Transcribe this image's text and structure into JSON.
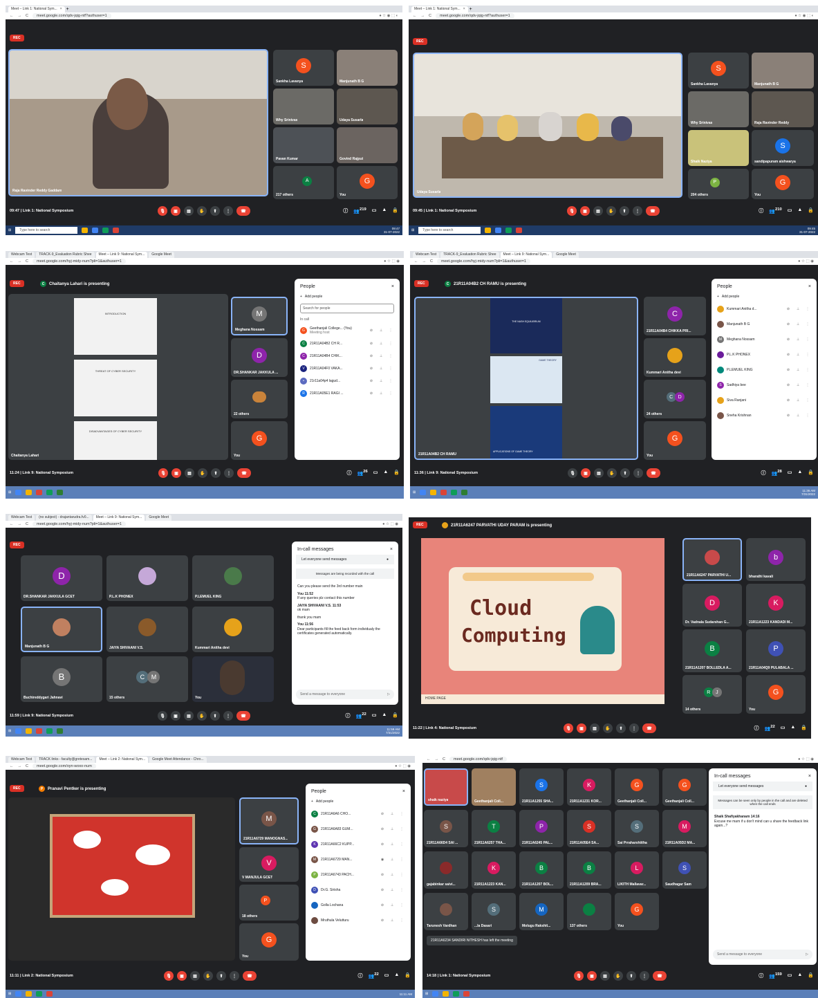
{
  "common": {
    "rec": "REC",
    "add_people": "Add people",
    "people": "People",
    "in_call": "In call",
    "search_people": "Search for people",
    "incall_messages": "In-call messages",
    "let_everyone": "Let everyone send messages",
    "taskbar_search": "Type here to search"
  },
  "s1": {
    "tab": "Meet – Link 1: National Sym...",
    "url": "meet.google.com/qdv-jqig-ntf?authuser=1",
    "main": "Raja Ravinder Reddy Gaddam",
    "tiles": [
      "Sankha Lavanya",
      "Manjunath B G",
      "Why Srinivas",
      "Udaya Susarla",
      "Pavan Kumar",
      "Govind Rajput",
      "217 others",
      "You"
    ],
    "time": "09:47",
    "meeting": "Link 1: National Symposium",
    "count": "219",
    "clock": "09:47",
    "date": "31-07-2022"
  },
  "s2": {
    "tab": "Meet – Link 1: National Sym...",
    "url": "meet.google.com/qdv-jqig-ntf?authuser=1",
    "main": "Udaya Susarla",
    "tiles": [
      "Sankha Lavanya",
      "Manjunath B G",
      "Why Srinivas",
      "Raja Ravinder Reddy",
      "Shaik Naziya",
      "sandipapuram aishwarya",
      "204 others",
      "You"
    ],
    "time": "09:45",
    "meeting": "Link 1: National Symposium",
    "count": "210",
    "clock": "09:45",
    "date": "31-07-2022"
  },
  "s3": {
    "tabs": [
      "Webcam Test",
      "TRACK-9_Evaluation Rubric Shee",
      "Meet – Link 9: National Sym...",
      "Google Meet"
    ],
    "url": "meet.google.com/hyj-midy-num?pli=1&authuser=1",
    "presenting": "Chaitanya Lahari is presenting",
    "main": "Chaitanya Lahari",
    "slides": [
      "INTRODUCTION",
      "THREAT OF CYBER SECURITY",
      "DISADVANTAGES OF CYBER SECURITY"
    ],
    "tiles": [
      "Meghana Nossam",
      "DR.SHANKAR JAKKULA ...",
      "22 others",
      "You"
    ],
    "people": [
      [
        "Geethanjali College... (You)",
        "Meeting host"
      ],
      [
        "21R11A04B2 CH R..."
      ],
      [
        "21R11A04B4 CHIK..."
      ],
      [
        "21R11A04F0 VAKA..."
      ],
      [
        "21r11a04p4 lagud..."
      ],
      [
        "21R11A05E1 RAGI ..."
      ]
    ],
    "time": "11:24",
    "meeting": "Link 9: National Symposium",
    "count": "26"
  },
  "s4": {
    "tabs": [
      "Webcam Test",
      "TRACK-9_Evaluation Rubric Shee",
      "Meet – Link 9: National Sym...",
      "Google Meet"
    ],
    "url": "meet.google.com/hyj-midy-num?pli=1&authuser=1",
    "presenting": "21R11A04B2 CH RAMU is presenting",
    "main": "21R11A04B2 CH RAMU",
    "slide_titles": [
      "THE NASH EQUILIBRIUM",
      "GAME THEORY",
      "APPLICATIONS OF GAME THEORY"
    ],
    "tiles": [
      "21R11A04B4 CHIKKA PRI...",
      "Kummari Anitha devi",
      "24 others",
      "You"
    ],
    "people": [
      "Kummari Anitha d...",
      "Manjunath B G",
      "Meghana Nossam",
      "P.L.K PHONEX",
      "P.LEMUEL KING",
      "Sadhiya bee",
      "Siva Ranjani",
      "Sneha Krishnan"
    ],
    "time": "11:36",
    "meeting": "Link 9: National Symposium",
    "count": "28",
    "clock": "11:36 AM",
    "date": "7/31/2022"
  },
  "s5": {
    "tabs": [
      "Webcam Test",
      "(no subject) - drajantarudra.fv0...",
      "Meet – Link 9: National Sym...",
      "Google Meet"
    ],
    "url": "meet.google.com/hyj-midy-num?pli=1&authuser=1",
    "tiles": [
      "DR.SHANKAR JAKKULA GCET",
      "P.L.K PHONEX",
      "P.LEMUEL KING",
      "Manjunath B G",
      "JAIYA SHIVAANI V.S.",
      "Kummari Anitha devi",
      "Buchireddygari Jahnavi",
      "15 others",
      "You"
    ],
    "recorded": "Messages are being recorded with the call",
    "msgs": [
      [
        "",
        "Can you please send the 3rd number main"
      ],
      [
        "You  11:52",
        "If any queries plz contact this number"
      ],
      [
        "JAIYA SHIVAANI V.S.  11:53",
        "ok mam"
      ],
      [
        "",
        "thank you mam"
      ],
      [
        "You  11:56",
        "Dear participants fill the feed back form individualy the certificates generated automatically."
      ]
    ],
    "send": "Send a message to everyone",
    "time": "11:59",
    "meeting": "Link 9: National Symposium",
    "count": "22",
    "clock": "11:59 AM",
    "date": "7/31/2022"
  },
  "s6": {
    "presenting": "21R11A6247 PARVATHI UDAY PARAM is presenting",
    "slide1": "Cloud",
    "slide2": "Computing",
    "home": "HOME PAGE",
    "tiles": [
      "21R11A6247 PARVATHI U...",
      "bharathi kavali",
      "Dr. Vadnala Sudarshan G...",
      "21R11A1223 KANDADI M...",
      "21R11A1207 BOLLEDLA A...",
      "21R11A04Q9 PULABALA ...",
      "14 others",
      "You"
    ],
    "time": "11:22",
    "meeting": "Link 4: National Symposium",
    "count": "22"
  },
  "s7": {
    "tabs": [
      "Webcam Test",
      "TRACK links - faculty@gretesam...",
      "Meet – Link 2: National Sym...",
      "Google Meet Attendance - Chro..."
    ],
    "url": "meet.google.com/oyn-woxo-num",
    "presenting": "Pranavi Pentker is presenting",
    "tiles": [
      "21R11A6729 MANOGNAS...",
      "V MANJULA GCET",
      "18 others",
      "You"
    ],
    "people": [
      "21R11A6A6 CHO...",
      "21R11A6A83 GUM...",
      "21R11A66C2 KUPP...",
      "21R11A6729 MAN...",
      "21R11A6743 PACH...",
      "Dr.G. Sirisha",
      "Golla Lochana",
      "Mruthula Velutturu"
    ],
    "time": "11:11",
    "meeting": "Link 2: National Symposium",
    "count": "22",
    "clock": "11:11 AM",
    "date": "7/31/2022"
  },
  "s8": {
    "url": "meet.google.com/qdv-jqig-ntf",
    "tiles": [
      "shaik naziya",
      "Geethanjali Coll...",
      "21R11A1255 SHA...",
      "21R11A1231 KOR...",
      "Geethanjali Coll...",
      "Geethanjali Coll...",
      "21R11A66D4 SAI ...",
      "21R11A6257 THA...",
      "21R11A6245 PAL...",
      "21R11A05E4 SA...",
      "Sai Prraharshiitha",
      "21R11A05D2 MA...",
      "gajabinkar saivi...",
      "21R11A1223 KAN...",
      "21R11A1207 BOL...",
      "21R11A1209 BRA...",
      "LIKITH Mallavar...",
      "Saudhagar Sam",
      "Tarunesh Vardhan",
      "...la Dasari",
      "Molugu Rakshit...",
      "137 others",
      "You"
    ],
    "left": "21R11A6234 SANDIRI NITHESH has left the meeting",
    "seen": "Messages can be seen only by people in the call and are deleted when the call ends",
    "msg_from": "Shaik Shafiyakhanam  14:16",
    "msg": "Excuse me mam if u don't mind can u share the feedback link again...?",
    "send": "Send a message to everyone",
    "time": "14:18",
    "meeting": "Link 1: National Symposium",
    "count": "159"
  }
}
